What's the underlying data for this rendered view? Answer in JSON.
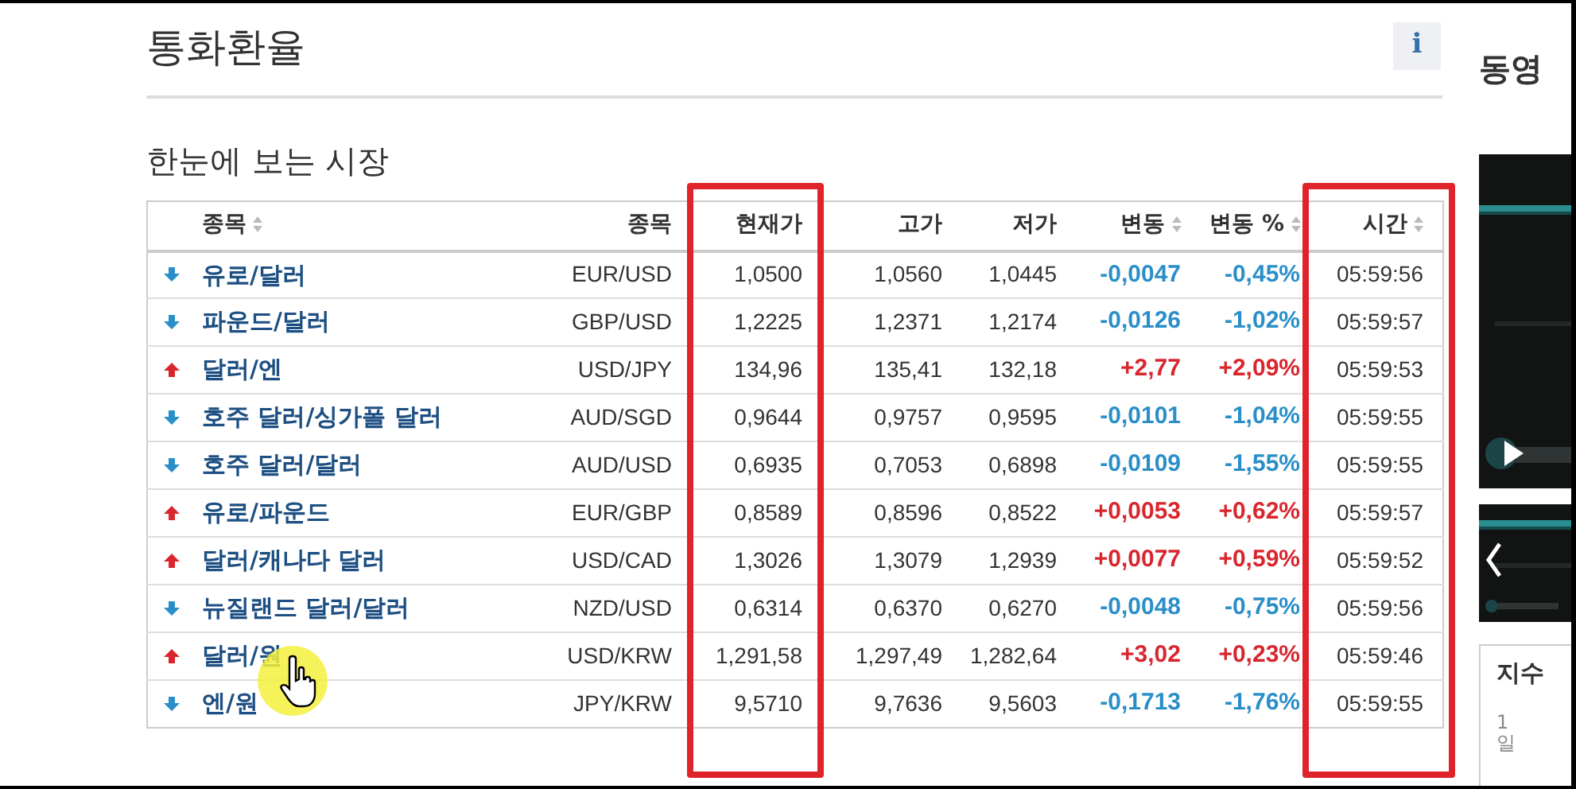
{
  "title": "통화환율",
  "info_button": "i",
  "section_title": "한눈에 보는 시장",
  "table": {
    "columns": [
      {
        "label": "종목",
        "sortable": true,
        "highlighted": false
      },
      {
        "label": "종목",
        "sortable": false,
        "highlighted": false
      },
      {
        "label": "현재가",
        "sortable": false,
        "highlighted": true
      },
      {
        "label": "고가",
        "sortable": false,
        "highlighted": false
      },
      {
        "label": "저가",
        "sortable": false,
        "highlighted": false
      },
      {
        "label": "변동",
        "sortable": true,
        "highlighted": false
      },
      {
        "label": "변동 %",
        "sortable": true,
        "highlighted": false
      },
      {
        "label": "시간",
        "sortable": true,
        "highlighted": true
      }
    ],
    "rows": [
      {
        "rising": false,
        "name": "유로/달러",
        "symbol": "EUR/USD",
        "last": "1,0500",
        "high": "1,0560",
        "low": "1,0445",
        "change": "-0,0047",
        "change_pct": "-0,45%",
        "time": "05:59:56"
      },
      {
        "rising": false,
        "name": "파운드/달러",
        "symbol": "GBP/USD",
        "last": "1,2225",
        "high": "1,2371",
        "low": "1,2174",
        "change": "-0,0126",
        "change_pct": "-1,02%",
        "time": "05:59:57"
      },
      {
        "rising": true,
        "name": "달러/엔",
        "symbol": "USD/JPY",
        "last": "134,96",
        "high": "135,41",
        "low": "132,18",
        "change": "+2,77",
        "change_pct": "+2,09%",
        "time": "05:59:53"
      },
      {
        "rising": false,
        "name": "호주 달러/싱가폴 달러",
        "symbol": "AUD/SGD",
        "last": "0,9644",
        "high": "0,9757",
        "low": "0,9595",
        "change": "-0,0101",
        "change_pct": "-1,04%",
        "time": "05:59:55"
      },
      {
        "rising": false,
        "name": "호주 달러/달러",
        "symbol": "AUD/USD",
        "last": "0,6935",
        "high": "0,7053",
        "low": "0,6898",
        "change": "-0,0109",
        "change_pct": "-1,55%",
        "time": "05:59:55"
      },
      {
        "rising": true,
        "name": "유로/파운드",
        "symbol": "EUR/GBP",
        "last": "0,8589",
        "high": "0,8596",
        "low": "0,8522",
        "change": "+0,0053",
        "change_pct": "+0,62%",
        "time": "05:59:57"
      },
      {
        "rising": true,
        "name": "달러/캐나다 달러",
        "symbol": "USD/CAD",
        "last": "1,3026",
        "high": "1,3079",
        "low": "1,2939",
        "change": "+0,0077",
        "change_pct": "+0,59%",
        "time": "05:59:52"
      },
      {
        "rising": false,
        "name": "뉴질랜드 달러/달러",
        "symbol": "NZD/USD",
        "last": "0,6314",
        "high": "0,6370",
        "low": "0,6270",
        "change": "-0,0048",
        "change_pct": "-0,75%",
        "time": "05:59:56"
      },
      {
        "rising": true,
        "name": "달러/원",
        "symbol": "USD/KRW",
        "last": "1,291,58",
        "high": "1,297,49",
        "low": "1,282,64",
        "change": "+3,02",
        "change_pct": "+0,23%",
        "time": "05:59:46"
      },
      {
        "rising": false,
        "name": "엔/원",
        "symbol": "JPY/KRW",
        "last": "9,5710",
        "high": "9,7636",
        "low": "9,5603",
        "change": "-0,1713",
        "change_pct": "-1,76%",
        "time": "05:59:55"
      }
    ]
  },
  "sidebar": {
    "title": "동영",
    "videos": [
      {
        "kind": "picture",
        "play_button": true,
        "prev_button": false
      },
      {
        "kind": "picture",
        "play_button": false,
        "prev_button": true
      }
    ],
    "tab": "지수",
    "tab_cell": "1일"
  }
}
